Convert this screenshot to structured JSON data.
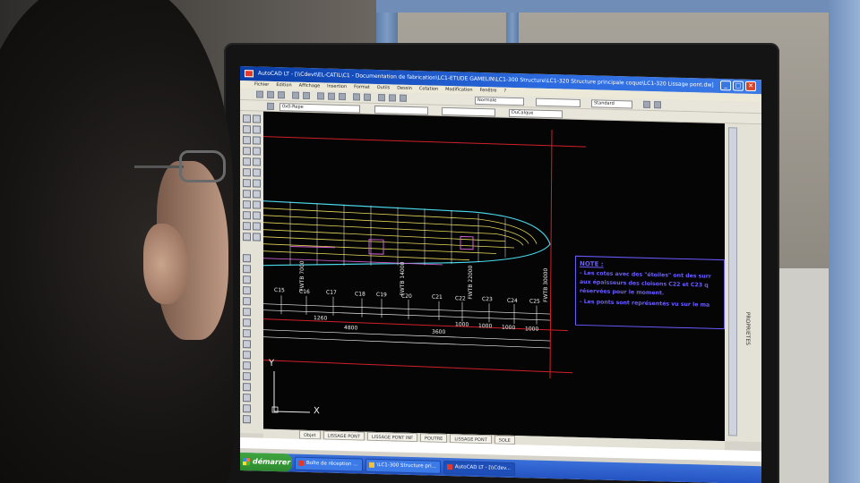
{
  "scene": {
    "description_icons": [
      "monitor",
      "person-silhouette"
    ]
  },
  "window": {
    "title": "AutoCAD LT - [\\\\Cdevt\\EL-CATIL\\C1 - Documentation de fabrication\\LC1-ETUDE GAMELIN\\LC1-300 Structure\\LC1-320 Structure principale coque\\LC1-320 Lissage pont.dw]",
    "menus": [
      "Fichier",
      "Edition",
      "Affichage",
      "Insertion",
      "Format",
      "Outils",
      "Dessin",
      "Cotation",
      "Modification",
      "Fenêtre",
      "?"
    ],
    "toolbar_layer": "0x0-Repe",
    "toolbar_style": "Standard",
    "toolbar_line": "Normale",
    "toolbar_layer2": "DuCalque",
    "close_label": "✕"
  },
  "drawing": {
    "frame_labels": [
      "C15",
      "C16",
      "C17",
      "C18",
      "C19",
      "C20",
      "C21",
      "C22",
      "C23",
      "C24",
      "C25"
    ],
    "vertical_labels": [
      "FWTB 7000",
      "FWTB 14000",
      "FWTB 22000",
      "FWTB 30000"
    ],
    "dims": [
      "1260",
      "4800",
      "3600",
      "1000",
      "1000",
      "1000",
      "1000"
    ],
    "axis_y": "Y",
    "axis_x": "X",
    "note": {
      "title": "NOTE :",
      "lines": [
        "- Les cotes avec des \"étoiles\" ont des surr",
        "aux épaisseurs des cloisons C22 et C23 q",
        "réservées pour le moment.",
        "- Les ponts sont représentés vu sur le ma"
      ]
    }
  },
  "right_panel_label": "PROPRIETES",
  "tabs": [
    "Objet",
    "LISSAGE PONT",
    "LISSAGE PONT INF",
    "POUTRE",
    "LISSAGE PONT",
    "SOLE"
  ],
  "taskbar": {
    "start": "démarrer",
    "tasks": [
      "Boîte de réception ...",
      "\\LC1-300 Structure pri...",
      "AutoCAD LT - [\\\\Cdev..."
    ]
  },
  "colors": {
    "canvas": "#050505",
    "red_lines": "#d0202a",
    "cyan": "#4ad6e8",
    "yellow": "#e8d85a",
    "note": "#6a5cff"
  }
}
